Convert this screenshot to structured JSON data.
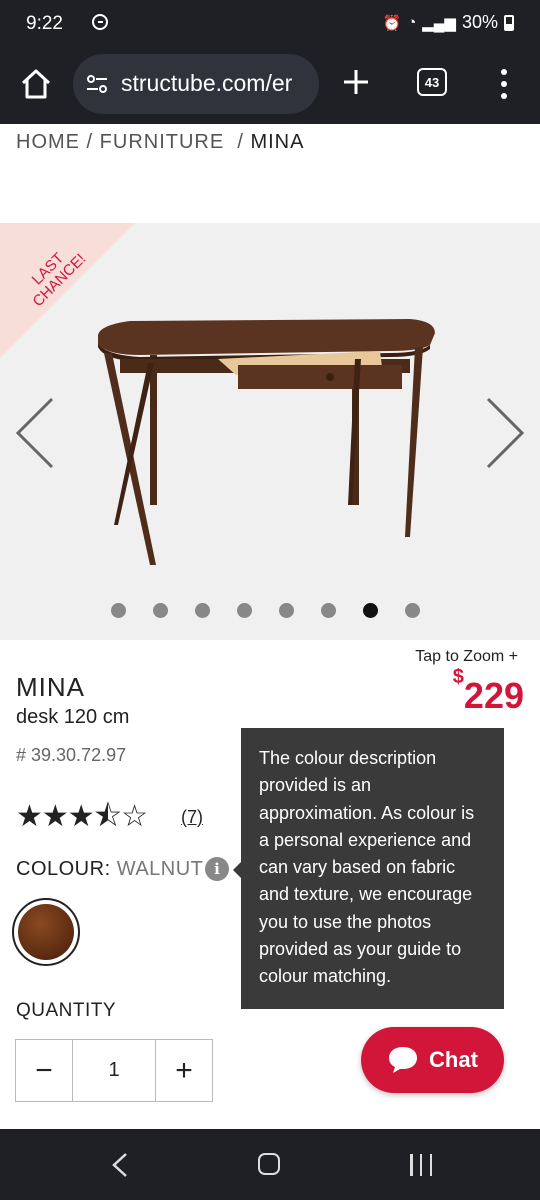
{
  "status_bar": {
    "time": "9:22",
    "battery": "30%"
  },
  "browser": {
    "url": "structube.com/er",
    "tab_count": "43"
  },
  "breadcrumb": {
    "home": "HOME",
    "sep1": " / ",
    "furniture": "FURNITURE",
    "sep2": "  / ",
    "current": "MINA"
  },
  "gallery": {
    "badge_line1": "LAST",
    "badge_line2": "CHANCE!",
    "image_count": 8,
    "active_index": 6,
    "tap_to_zoom": "Tap to Zoom"
  },
  "product": {
    "name": "MINA",
    "description": "desk 120 cm",
    "sku": "# 39.30.72.97",
    "currency": "$",
    "price": "229",
    "rating": 3.5,
    "stars": "★★★⯪☆",
    "review_count": "(7)",
    "colour_label": "COLOUR: ",
    "colour_value": "WALNUT"
  },
  "tooltip": {
    "text": "The colour description provided is an approximation. As colour is a personal experience and can vary based on fabric and texture, we encourage you to use the photos provided as your guide to colour matching."
  },
  "quantity": {
    "label": "QUANTITY",
    "value": "1",
    "minus": "−",
    "plus": "+"
  },
  "chat": {
    "label": "Chat"
  },
  "colors": {
    "accent": "#d1163a",
    "chrome": "#1f2026"
  }
}
